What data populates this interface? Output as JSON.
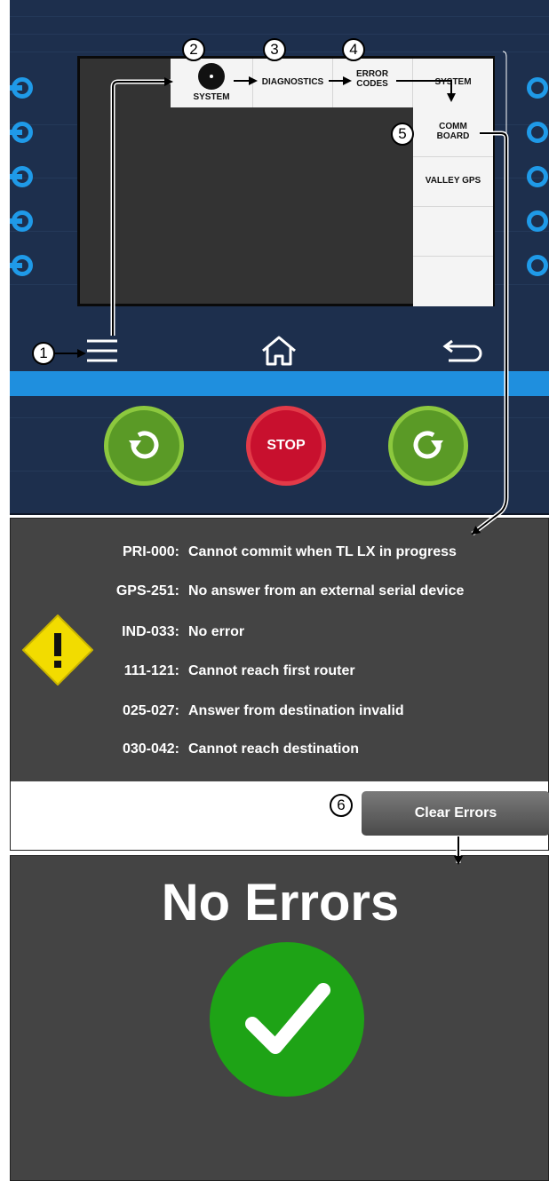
{
  "controller": {
    "menu": {
      "system_label": "SYSTEM",
      "diagnostics_label": "DIAGNOSTICS",
      "error_codes_label": "ERROR CODES",
      "system_tab_label": "SYSTEM"
    },
    "submenu": {
      "comm_board_label": "COMM BOARD",
      "valley_gps_label": "VALLEY GPS"
    },
    "nav": {
      "menu_icon": "hamburger-menu-icon",
      "home_icon": "home-icon",
      "back_icon": "back-arrow-icon"
    },
    "buttons": {
      "reverse_icon": "rotate-counterclockwise-icon",
      "stop_label": "STOP",
      "forward_icon": "rotate-clockwise-icon"
    }
  },
  "errors": {
    "warning_icon": "warning-diamond-icon",
    "list": [
      {
        "code": "PRI-000:",
        "message": "Cannot commit when TL LX in progress"
      },
      {
        "code": "GPS-251:",
        "message": "No answer from an external serial device"
      },
      {
        "code": "IND-033:",
        "message": "No error"
      },
      {
        "code": "111-121:",
        "message": "Cannot reach first router"
      },
      {
        "code": "025-027:",
        "message": "Answer from destination invalid"
      },
      {
        "code": "030-042:",
        "message": "Cannot reach destination"
      }
    ],
    "clear_button_label": "Clear Errors"
  },
  "result": {
    "title": "No Errors",
    "icon": "checkmark-icon"
  },
  "callouts": [
    "1",
    "2",
    "3",
    "4",
    "5",
    "6"
  ],
  "colors": {
    "panel_navy": "#1d2f4d",
    "accent_blue": "#1f8fde",
    "green_button": "#5a9a26",
    "stop_red": "#c8102e",
    "warning_yellow": "#f2dc00",
    "success_green": "#1ea316",
    "screen_gray": "#444444"
  }
}
